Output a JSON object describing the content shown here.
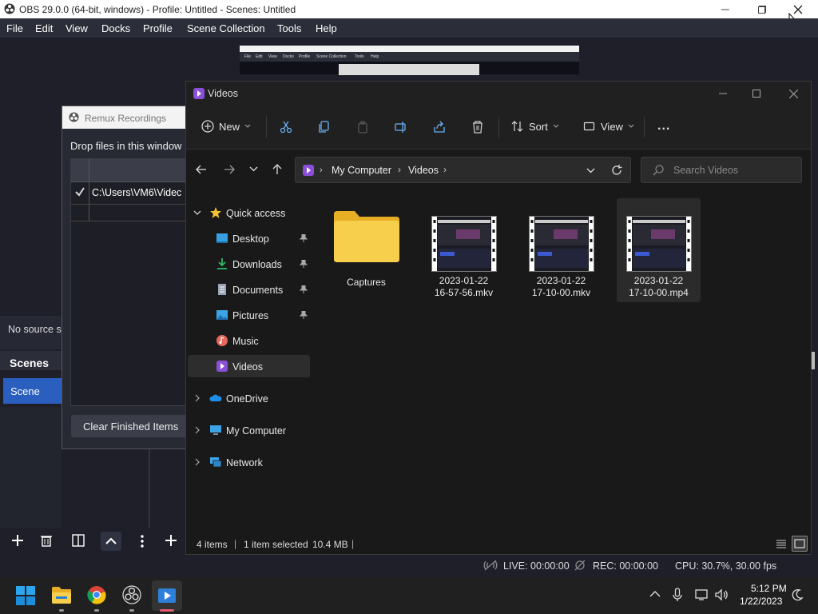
{
  "obs": {
    "title": "OBS 29.0.0 (64-bit, windows) - Profile: Untitled - Scenes: Untitled",
    "menu": [
      "File",
      "Edit",
      "View",
      "Docks",
      "Profile",
      "Scene Collection",
      "Tools",
      "Help"
    ],
    "no_source": "No source s",
    "scenes_title": "Scenes",
    "scene_item": "Scene",
    "status": {
      "live": "LIVE: 00:00:00",
      "rec": "REC: 00:00:00",
      "cpu": "CPU: 30.7%, 30.00 fps"
    }
  },
  "remux": {
    "title": "Remux Recordings",
    "drop_text": "Drop files in this window",
    "row_path": "C:\\Users\\VM6\\Videc",
    "clear_button": "Clear Finished Items"
  },
  "explorer": {
    "title": "Videos",
    "toolbar": {
      "new": "New",
      "sort": "Sort",
      "view": "View",
      "more": "..."
    },
    "breadcrumb": [
      "My Computer",
      "Videos"
    ],
    "search_placeholder": "Search Videos",
    "nav": {
      "quick_access": "Quick access",
      "items": [
        {
          "label": "Desktop",
          "icon": "desktop-icon",
          "pinned": true
        },
        {
          "label": "Downloads",
          "icon": "downloads-icon",
          "pinned": true
        },
        {
          "label": "Documents",
          "icon": "documents-icon",
          "pinned": true
        },
        {
          "label": "Pictures",
          "icon": "pictures-icon",
          "pinned": true
        },
        {
          "label": "Music",
          "icon": "music-icon",
          "pinned": false
        },
        {
          "label": "Videos",
          "icon": "videos-icon",
          "pinned": false,
          "selected": true
        }
      ],
      "roots": [
        {
          "label": "OneDrive",
          "icon": "onedrive-icon"
        },
        {
          "label": "My Computer",
          "icon": "computer-icon"
        },
        {
          "label": "Network",
          "icon": "network-icon"
        }
      ]
    },
    "files": [
      {
        "name_line1": "Captures",
        "name_line2": "",
        "type": "folder"
      },
      {
        "name_line1": "2023-01-22",
        "name_line2": "16-57-56.mkv",
        "type": "video"
      },
      {
        "name_line1": "2023-01-22",
        "name_line2": "17-10-00.mkv",
        "type": "video"
      },
      {
        "name_line1": "2023-01-22",
        "name_line2": "17-10-00.mp4",
        "type": "video",
        "selected": true
      }
    ],
    "status": {
      "count": "4 items",
      "selected": "1 item selected",
      "size": "10.4 MB"
    }
  },
  "taskbar": {
    "time": "5:12 PM",
    "date": "1/22/2023"
  },
  "preview_menu": [
    "File",
    "Edit",
    "View",
    "Docks",
    "Profile",
    "Scene Collection",
    "Tools",
    "Help"
  ],
  "colors": {
    "accent": "#2a5ebf",
    "folder": "#f3c53f",
    "obs_bg": "#1e1f29",
    "explorer_bg": "#191919"
  }
}
